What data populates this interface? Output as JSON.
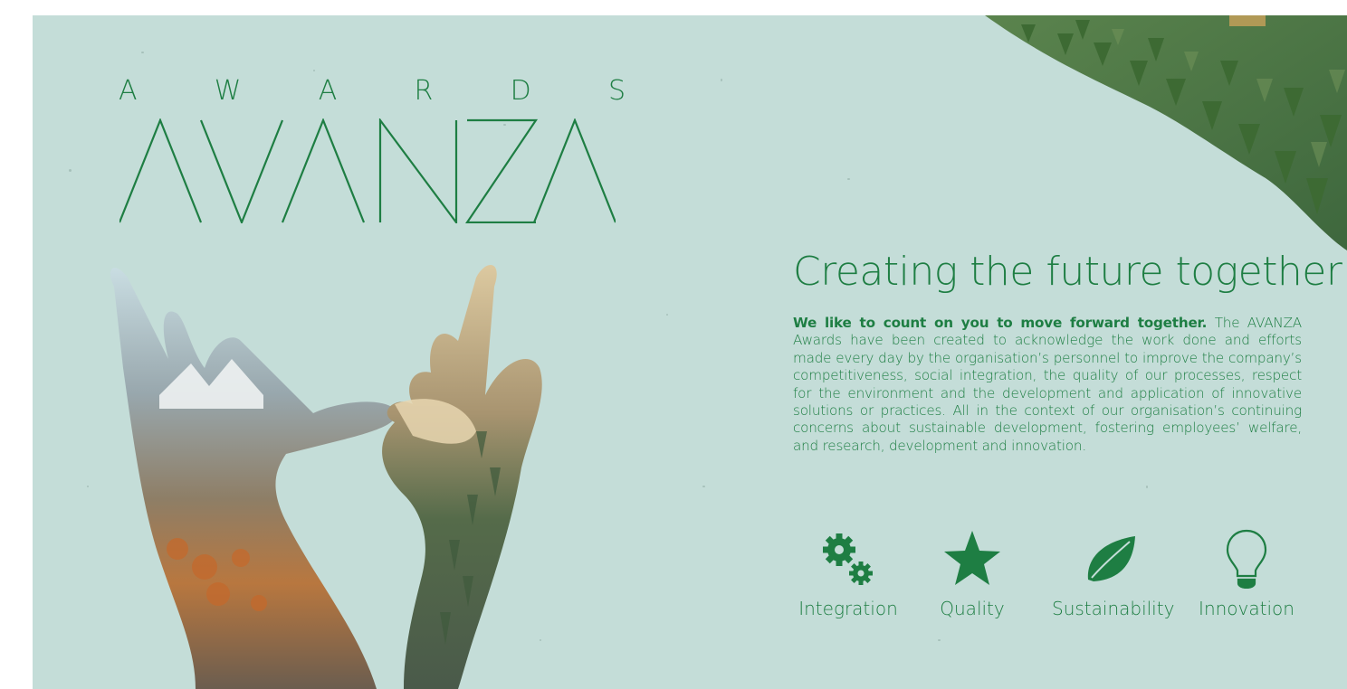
{
  "brand": {
    "awards_letters": [
      "A",
      "W",
      "A",
      "R",
      "D",
      "S"
    ],
    "logo_text": "AVANZA",
    "color": "#1e7e43",
    "background": "#c4ddd8"
  },
  "headline": "Creating the future together",
  "intro": {
    "lead": "We like to count on you to move forward together.",
    "text": " The AVANZA Awards have been created to acknowledge the work done and efforts made every day by the organisation’s personnel to improve the company’s competitiveness, social integration, the quality of our processes, respect for the environment and the development and application of innovative solutions or practices. All in the context of our organisation’s continuing concerns about sustainable development, fostering employees’ welfare, and research, development and innovation."
  },
  "values": [
    {
      "icon": "gears-icon",
      "label": "Integration"
    },
    {
      "icon": "star-icon",
      "label": "Quality"
    },
    {
      "icon": "leaf-icon",
      "label": "Sustainability"
    },
    {
      "icon": "lightbulb-icon",
      "label": "Innovation"
    }
  ]
}
